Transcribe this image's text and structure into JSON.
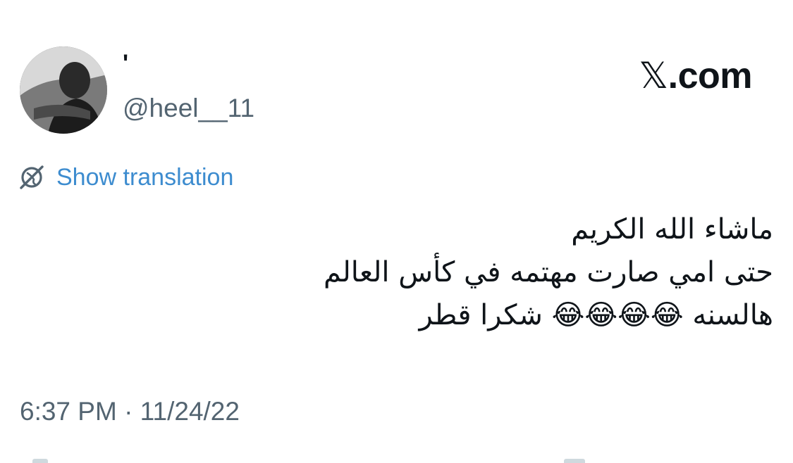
{
  "author": {
    "display_name": "'",
    "handle": "@heel__11"
  },
  "brand": {
    "mark": "𝕏",
    "suffix": ".com"
  },
  "translation": {
    "label": "Show translation",
    "icon": "translate-globe-icon"
  },
  "tweet": {
    "lines": [
      "ماشاء الله الكريم",
      "حتى امي صارت مهتمه في كأس العالم",
      "هالسنه 😂😂😂😂 شكرا قطر"
    ]
  },
  "meta": {
    "timestamp": "6:37 PM · 11/24/22"
  },
  "colors": {
    "text": "#0f1419",
    "secondary": "#536471",
    "link": "#3d8ccf"
  }
}
